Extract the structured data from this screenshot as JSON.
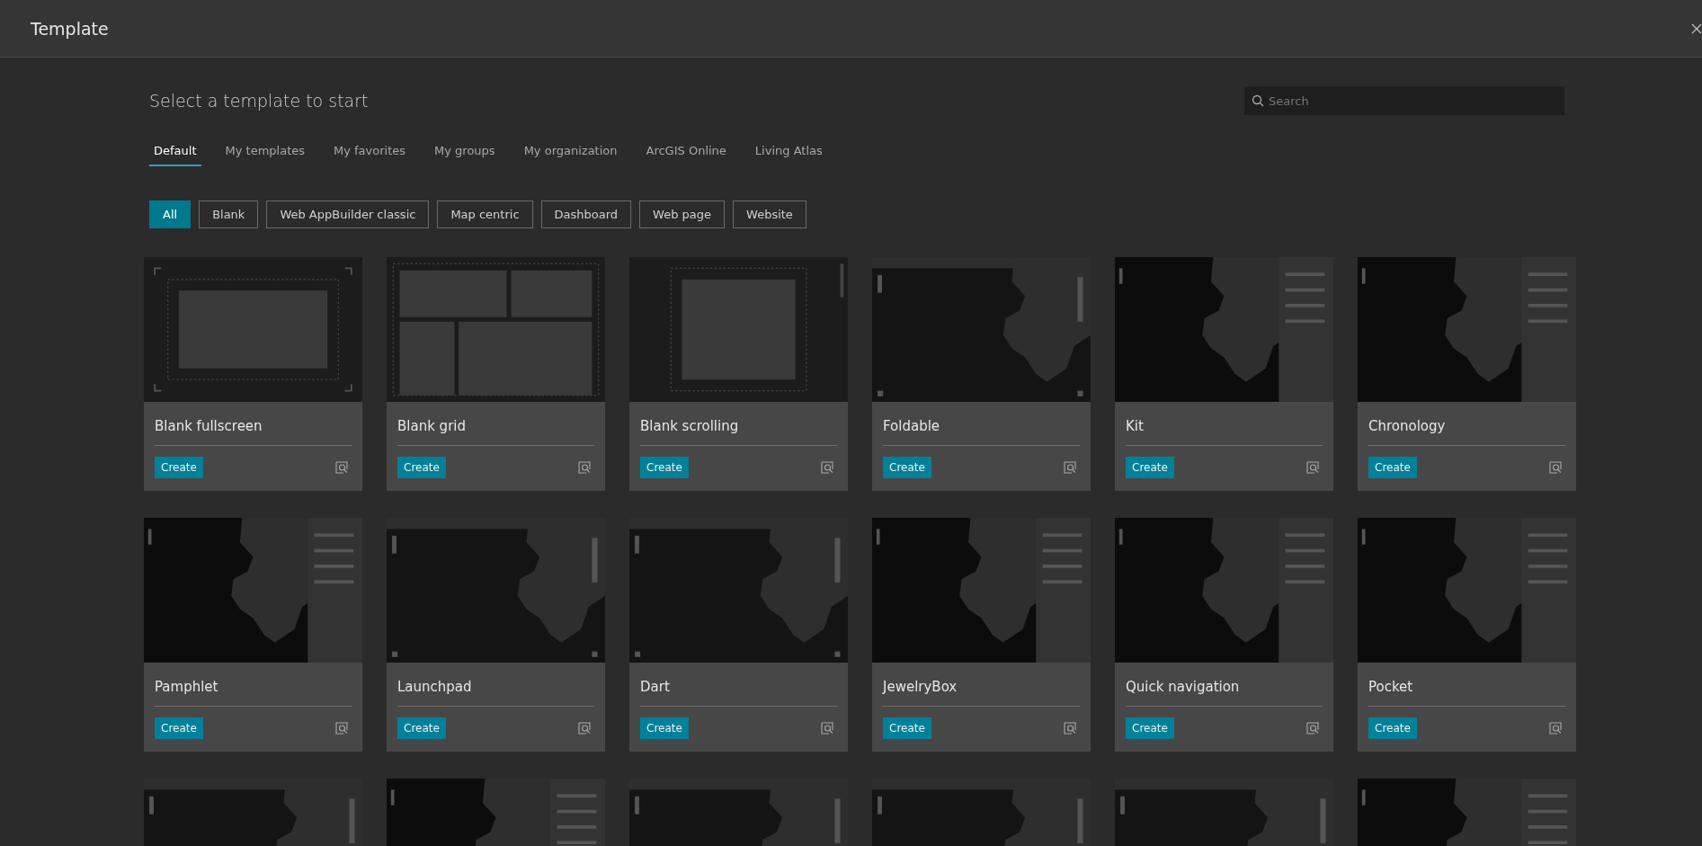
{
  "window": {
    "title": "Template"
  },
  "heading": "Select a template to start",
  "search": {
    "placeholder": "Search"
  },
  "tabs": [
    {
      "label": "Default",
      "selected": true
    },
    {
      "label": "My templates",
      "selected": false
    },
    {
      "label": "My favorites",
      "selected": false
    },
    {
      "label": "My groups",
      "selected": false
    },
    {
      "label": "My organization",
      "selected": false
    },
    {
      "label": "ArcGIS Online",
      "selected": false
    },
    {
      "label": "Living Atlas",
      "selected": false
    }
  ],
  "filters": [
    {
      "label": "All",
      "selected": true
    },
    {
      "label": "Blank",
      "selected": false
    },
    {
      "label": "Web AppBuilder classic",
      "selected": false
    },
    {
      "label": "Map centric",
      "selected": false
    },
    {
      "label": "Dashboard",
      "selected": false
    },
    {
      "label": "Web page",
      "selected": false
    },
    {
      "label": "Website",
      "selected": false
    }
  ],
  "cards": [
    {
      "title": "Blank fullscreen",
      "kind": "frame",
      "button": "Create"
    },
    {
      "title": "Blank grid",
      "kind": "grid",
      "button": "Create"
    },
    {
      "title": "Blank scrolling",
      "kind": "scroll",
      "button": "Create"
    },
    {
      "title": "Foldable",
      "kind": "map",
      "button": "Create"
    },
    {
      "title": "Kit",
      "kind": "panel",
      "button": "Create"
    },
    {
      "title": "Chronology",
      "kind": "panel",
      "button": "Create"
    },
    {
      "title": "Pamphlet",
      "kind": "panel",
      "button": "Create"
    },
    {
      "title": "Launchpad",
      "kind": "map",
      "button": "Create"
    },
    {
      "title": "Dart",
      "kind": "map",
      "button": "Create"
    },
    {
      "title": "JewelryBox",
      "kind": "panel",
      "button": "Create"
    },
    {
      "title": "Quick navigation",
      "kind": "panel",
      "button": "Create"
    },
    {
      "title": "Pocket",
      "kind": "panel",
      "button": "Create"
    }
  ],
  "partial_cards": [
    {
      "kind": "map"
    },
    {
      "kind": "panel"
    },
    {
      "kind": "map"
    },
    {
      "kind": "map"
    },
    {
      "kind": "map"
    },
    {
      "kind": "panel"
    }
  ]
}
